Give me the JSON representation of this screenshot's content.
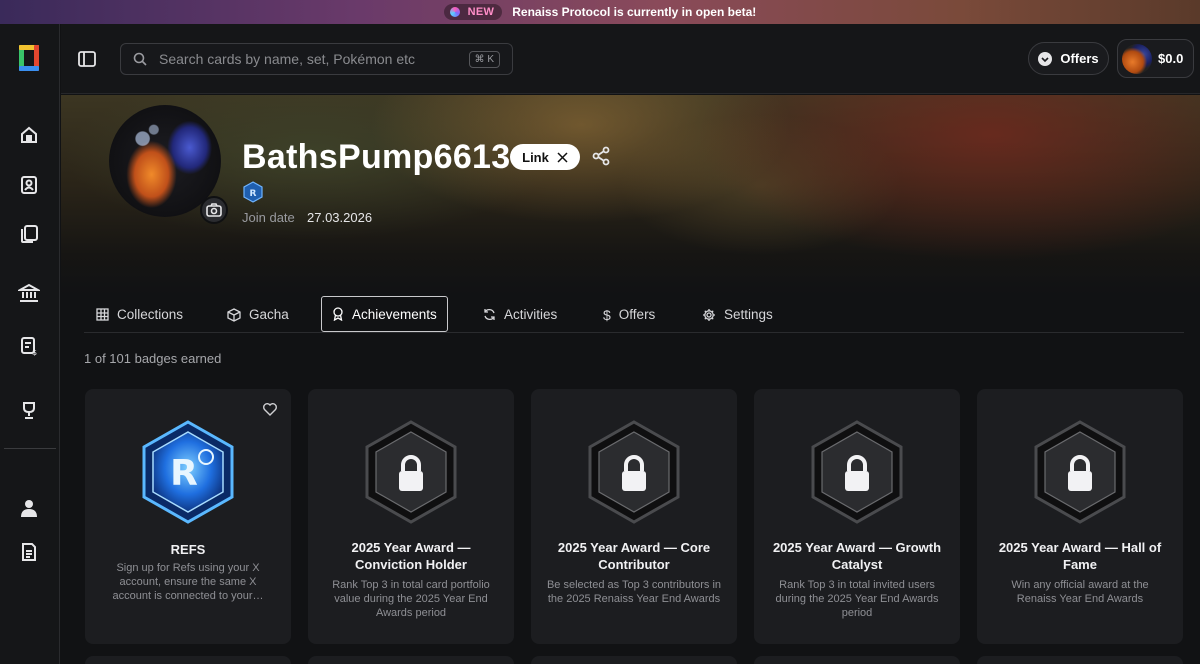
{
  "banner": {
    "tag": "NEW",
    "message": "Renaiss Protocol is currently in open beta!"
  },
  "header": {
    "search": {
      "placeholder": "Search cards by name, set, Pokémon etc",
      "shortcut": "⌘ K"
    },
    "offers_label": "Offers",
    "wallet_balance": "$0.0"
  },
  "profile": {
    "username": "BathsPump6613",
    "link_label": "Link",
    "join_label": "Join date",
    "join_date": "27.03.2026"
  },
  "tabs": [
    {
      "label": "Collections",
      "icon": "grid-icon"
    },
    {
      "label": "Gacha",
      "icon": "gacha-icon"
    },
    {
      "label": "Achievements",
      "icon": "award-icon",
      "active": true
    },
    {
      "label": "Activities",
      "icon": "refresh-icon"
    },
    {
      "label": "Offers",
      "icon": "dollar-icon"
    },
    {
      "label": "Settings",
      "icon": "gear-icon"
    }
  ],
  "achievements": {
    "earned_text": "1 of 101 badges earned",
    "cards": [
      {
        "title": "REFS",
        "desc": "Sign up for Refs using your X account, ensure the same X account is connected to your…",
        "locked": false
      },
      {
        "title": "2025 Year Award — Conviction Holder",
        "desc": "Rank Top 3 in total card portfolio value during the 2025 Year End Awards period",
        "locked": true
      },
      {
        "title": "2025 Year Award — Core Contributor",
        "desc": "Be selected as Top 3 contributors in the 2025 Renaiss Year End Awards",
        "locked": true
      },
      {
        "title": "2025 Year Award — Growth Catalyst",
        "desc": "Rank Top 3 in total invited users during the 2025 Year End Awards period",
        "locked": true
      },
      {
        "title": "2025 Year Award — Hall of Fame",
        "desc": "Win any official award at the Renaiss Year End Awards",
        "locked": true
      }
    ]
  },
  "colors": {
    "accent": "#ff8ec8",
    "background": "#111214",
    "card": "#1c1d20",
    "refs_badge": "#2a8cff"
  }
}
